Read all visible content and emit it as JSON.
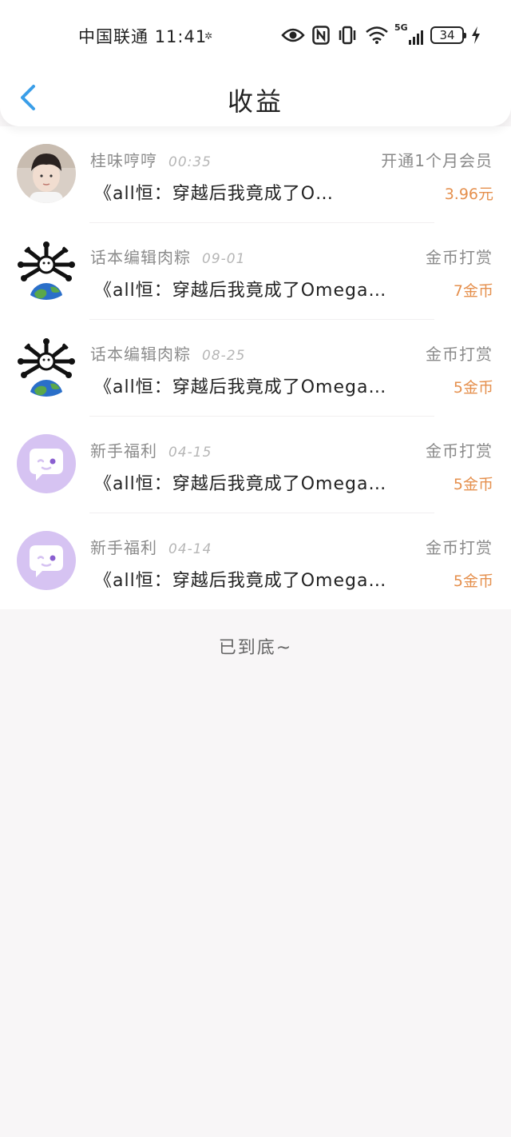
{
  "status": {
    "carrier": "中国联通",
    "time": "11:41",
    "battery": "34",
    "network": "5G"
  },
  "nav": {
    "title": "收益",
    "back_icon": "chevron-left-icon"
  },
  "colors": {
    "accent_blue": "#3a9ee8",
    "amount_orange": "#e5904e",
    "muted_text": "#8c8c8c"
  },
  "records": [
    {
      "name": "桂味哼哼",
      "time": "00:35",
      "type": "开通1个月会员",
      "book": "《all恒：穿越后我竟成了O…",
      "amount": "3.96元",
      "avatar": "photo-avatar"
    },
    {
      "name": "话本编辑肉粽",
      "time": "09-01",
      "type": "金币打赏",
      "book": "《all恒：穿越后我竟成了Omega…",
      "amount": "7金币",
      "avatar": "earth-bones-avatar"
    },
    {
      "name": "话本编辑肉粽",
      "time": "08-25",
      "type": "金币打赏",
      "book": "《all恒：穿越后我竟成了Omega…",
      "amount": "5金币",
      "avatar": "earth-bones-avatar"
    },
    {
      "name": "新手福利",
      "time": "04-15",
      "type": "金币打赏",
      "book": "《all恒：穿越后我竟成了Omega…",
      "amount": "5金币",
      "avatar": "chat-bubble-avatar"
    },
    {
      "name": "新手福利",
      "time": "04-14",
      "type": "金币打赏",
      "book": "《all恒：穿越后我竟成了Omega…",
      "amount": "5金币",
      "avatar": "chat-bubble-avatar"
    }
  ],
  "footer": {
    "end_text": "已到底~"
  }
}
